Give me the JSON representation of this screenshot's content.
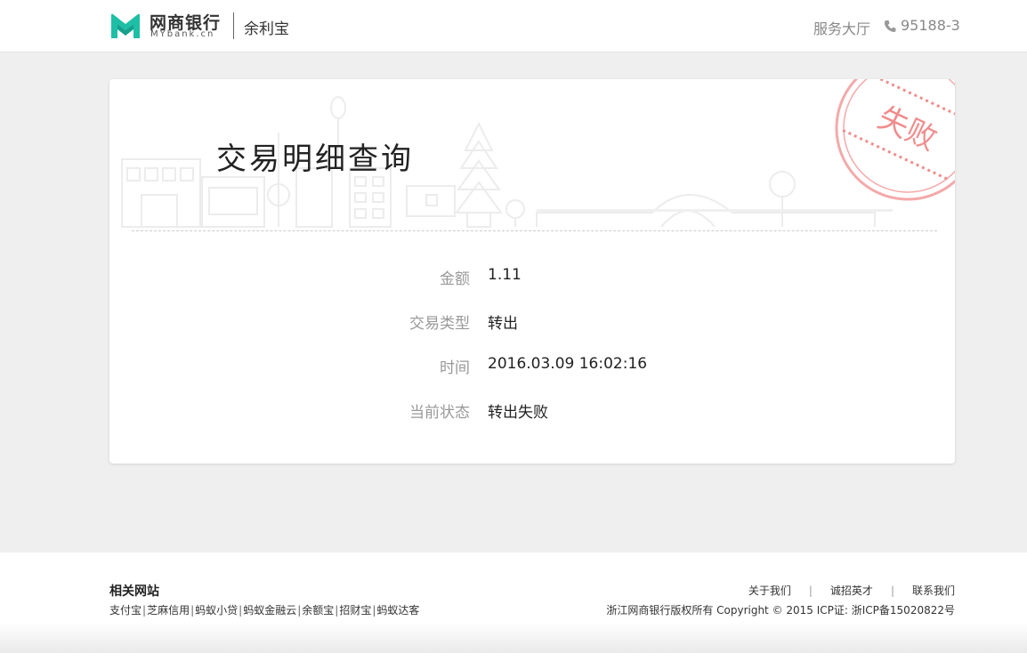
{
  "header": {
    "brand_cn": "网商银行",
    "brand_en": "MYbank.cn",
    "product": "余利宝",
    "service_hall": "服务大厅",
    "phone": "95188-3"
  },
  "card": {
    "title": "交易明细查询",
    "stamp_text": "失败",
    "rows": [
      {
        "label": "金额",
        "value": "1.11"
      },
      {
        "label": "交易类型",
        "value": "转出"
      },
      {
        "label": "时间",
        "value": "2016.03.09 16:02:16"
      },
      {
        "label": "当前状态",
        "value": "转出失败"
      }
    ]
  },
  "footer": {
    "related_title": "相关网站",
    "related_links": [
      "支付宝",
      "芝麻信用",
      "蚂蚁小贷",
      "蚂蚁金融云",
      "余额宝",
      "招财宝",
      "蚂蚁达客"
    ],
    "nav": [
      "关于我们",
      "诚招英才",
      "联系我们"
    ],
    "copyright": "浙江网商银行版权所有 Copyright © 2015 ICP证: 浙ICP备15020822号"
  },
  "colors": {
    "brand": "#1ebfa6",
    "stamp": "#f08d8d",
    "background": "#efefef"
  }
}
